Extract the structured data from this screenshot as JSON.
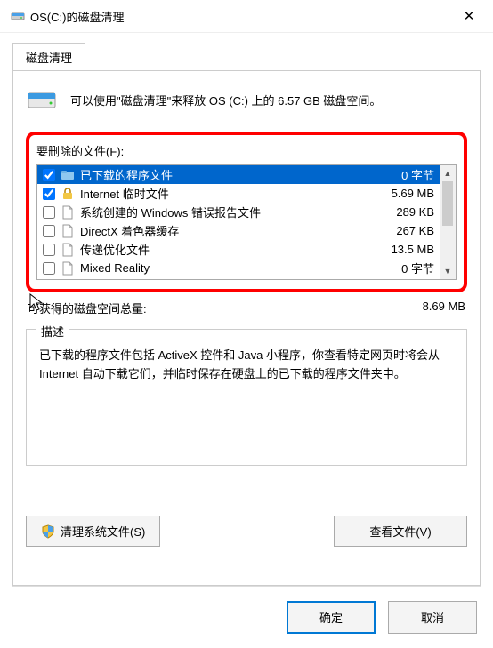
{
  "titlebar": {
    "title": "OS(C:)的磁盘清理"
  },
  "tab": {
    "label": "磁盘清理"
  },
  "info_text": "可以使用\"磁盘清理\"来释放 OS (C:) 上的 6.57 GB 磁盘空间。",
  "list": {
    "label": "要删除的文件(F):",
    "items": [
      {
        "checked": true,
        "icon": "folder-icon",
        "name": "已下载的程序文件",
        "size": "0 字节"
      },
      {
        "checked": true,
        "icon": "lock-icon",
        "name": "Internet 临时文件",
        "size": "5.69 MB"
      },
      {
        "checked": false,
        "icon": "file-icon",
        "name": "系统创建的 Windows 错误报告文件",
        "size": "289 KB"
      },
      {
        "checked": false,
        "icon": "file-icon",
        "name": "DirectX 着色器缓存",
        "size": "267 KB"
      },
      {
        "checked": false,
        "icon": "file-icon",
        "name": "传递优化文件",
        "size": "13.5 MB"
      },
      {
        "checked": false,
        "icon": "file-icon",
        "name": "Mixed Reality",
        "size": "0 字节"
      }
    ]
  },
  "total": {
    "label": "可获得的磁盘空间总量:",
    "value": "8.69 MB"
  },
  "description": {
    "label": "描述",
    "body": "已下载的程序文件包括 ActiveX 控件和 Java 小程序，你查看特定网页时将会从 Internet 自动下载它们，并临时保存在硬盘上的已下载的程序文件夹中。"
  },
  "buttons": {
    "clean_system": "清理系统文件(S)",
    "view_files": "查看文件(V)",
    "ok": "确定",
    "cancel": "取消"
  }
}
